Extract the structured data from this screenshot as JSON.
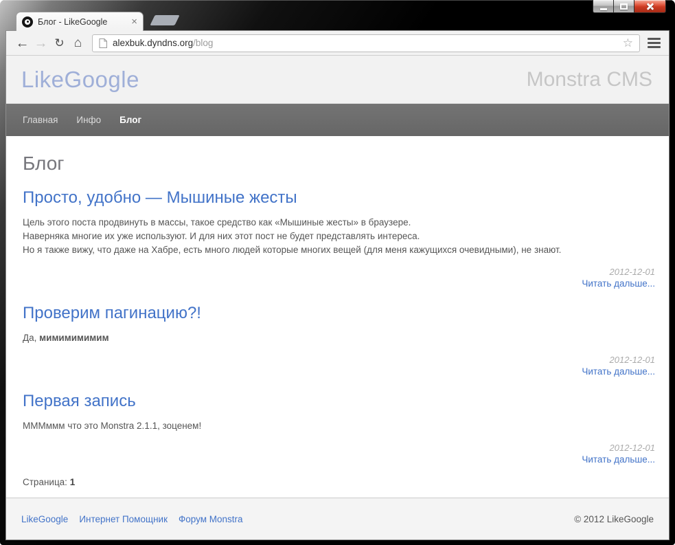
{
  "browser": {
    "tab_title": "Блог - LikeGoogle",
    "url_domain": "alexbuk.dyndns.org",
    "url_path": "/blog"
  },
  "icons": {
    "back": "←",
    "forward": "→",
    "reload": "↻",
    "home": "⌂",
    "bookmark_star": "☆",
    "tab_close": "×"
  },
  "site": {
    "logo": "LikeGoogle",
    "tagline": "Monstra CMS",
    "nav": [
      {
        "label": "Главная",
        "active": false
      },
      {
        "label": "Инфо",
        "active": false
      },
      {
        "label": "Блог",
        "active": true
      }
    ],
    "page_title": "Блог",
    "posts": [
      {
        "title": "Просто, удобно — Мышиные жесты",
        "body_lines": [
          "Цель этого поста продвинуть в массы, такое средство как «Мышиные жесты» в браузере.",
          "Наверняка многие их уже используют. И для них этот пост не будет представлять интереса.",
          "Но я также вижу, что даже на Хабре, есть много людей которые многих вещей (для меня кажущихся очевидными), не знают."
        ],
        "date": "2012-12-01",
        "read_more": "Читать дальше..."
      },
      {
        "title": "Проверим пагинацию?!",
        "body_prefix": "Да, ",
        "body_bold": "мимимимимим",
        "date": "2012-12-01",
        "read_more": "Читать дальше..."
      },
      {
        "title": "Первая запись",
        "body": "МММммм что это Monstra 2.1.1, зоценем!",
        "date": "2012-12-01",
        "read_more": "Читать дальше..."
      }
    ],
    "pagination": {
      "label": "Страница:",
      "current": "1"
    },
    "footer": {
      "links": [
        "LikeGoogle",
        "Интернет Помощник",
        "Форум Monstra"
      ],
      "copyright": "© 2012 LikeGoogle"
    }
  },
  "colors": {
    "link_blue": "#4273c8",
    "logo_blue": "#9fafd8",
    "nav_bg": "#6b6b6b",
    "header_bg": "#f2f2f2",
    "footer_bg": "#f4f4f4",
    "toolbar_bg": "#f2f2f2",
    "close_button_red": "#cc3a22"
  }
}
